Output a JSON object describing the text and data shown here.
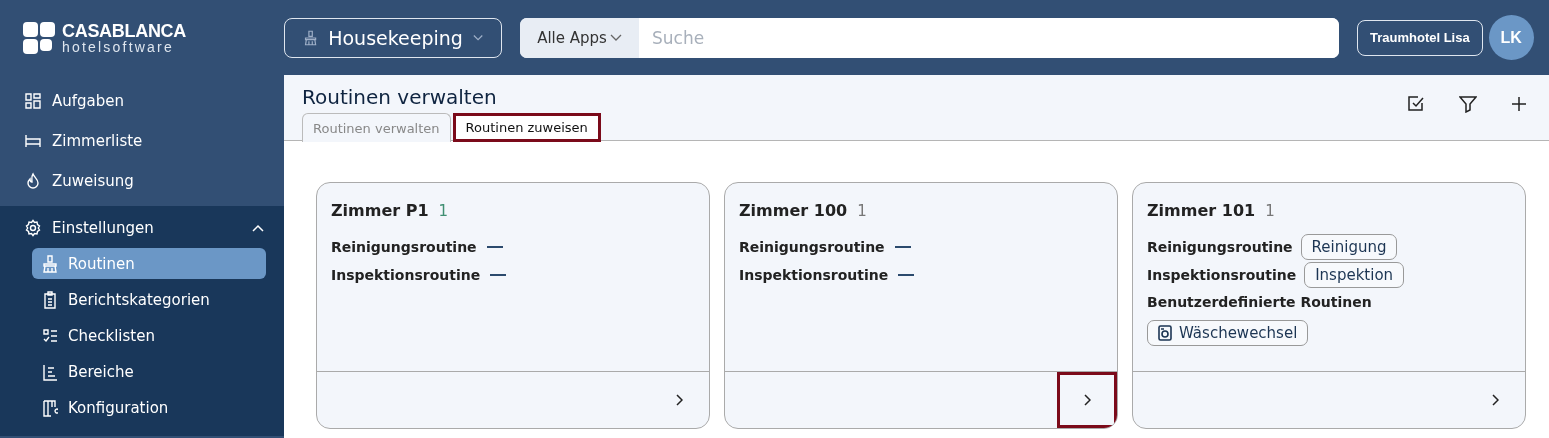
{
  "logo": {
    "name": "CASABLANCA",
    "tagline": "hotelsoftware"
  },
  "app_switcher": {
    "label": "Housekeeping"
  },
  "search": {
    "scope": "Alle Apps",
    "placeholder": "Suche"
  },
  "hotel_button": "Traumhotel Lisa",
  "avatar": "LK",
  "sidebar": {
    "items": [
      {
        "label": "Aufgaben",
        "selected": false
      },
      {
        "label": "Zimmerliste",
        "selected": false
      },
      {
        "label": "Zuweisung",
        "selected": false
      },
      {
        "label": "Einstellungen",
        "selected": false,
        "expanded": true,
        "children": [
          {
            "label": "Routinen",
            "selected": true
          },
          {
            "label": "Berichtskategorien",
            "selected": false
          },
          {
            "label": "Checklisten",
            "selected": false
          },
          {
            "label": "Bereiche",
            "selected": false
          },
          {
            "label": "Konfiguration",
            "selected": false
          }
        ]
      }
    ]
  },
  "page": {
    "title": "Routinen verwalten",
    "tabs": [
      {
        "label": "Routinen verwalten",
        "selected": false,
        "highlighted": false
      },
      {
        "label": "Routinen zuweisen",
        "selected": true,
        "highlighted": true
      }
    ]
  },
  "cards": [
    {
      "title": "Zimmer P1",
      "count": "1",
      "color": "#3f8f72",
      "highlighted": false,
      "routines": [
        {
          "label": "Reinigungsroutine",
          "kind": "empty"
        },
        {
          "label": "Inspektionsroutine",
          "kind": "empty"
        }
      ]
    },
    {
      "title": "Zimmer 100",
      "count": "1",
      "color": "#777777",
      "highlighted": true,
      "routines": [
        {
          "label": "Reinigungsroutine",
          "kind": "empty"
        },
        {
          "label": "Inspektionsroutine",
          "kind": "empty"
        }
      ]
    },
    {
      "title": "Zimmer 101",
      "count": "1",
      "color": "#777777",
      "highlighted": false,
      "routines": [
        {
          "label": "Reinigungsroutine",
          "value": "Reinigung",
          "kind": "chip"
        },
        {
          "label": "Inspektionsroutine",
          "value": "Inspektion",
          "kind": "chip"
        }
      ],
      "custom": {
        "heading": "Benutzerdefinierte Routinen",
        "chips": [
          "Wäschewechsel"
        ]
      }
    }
  ]
}
